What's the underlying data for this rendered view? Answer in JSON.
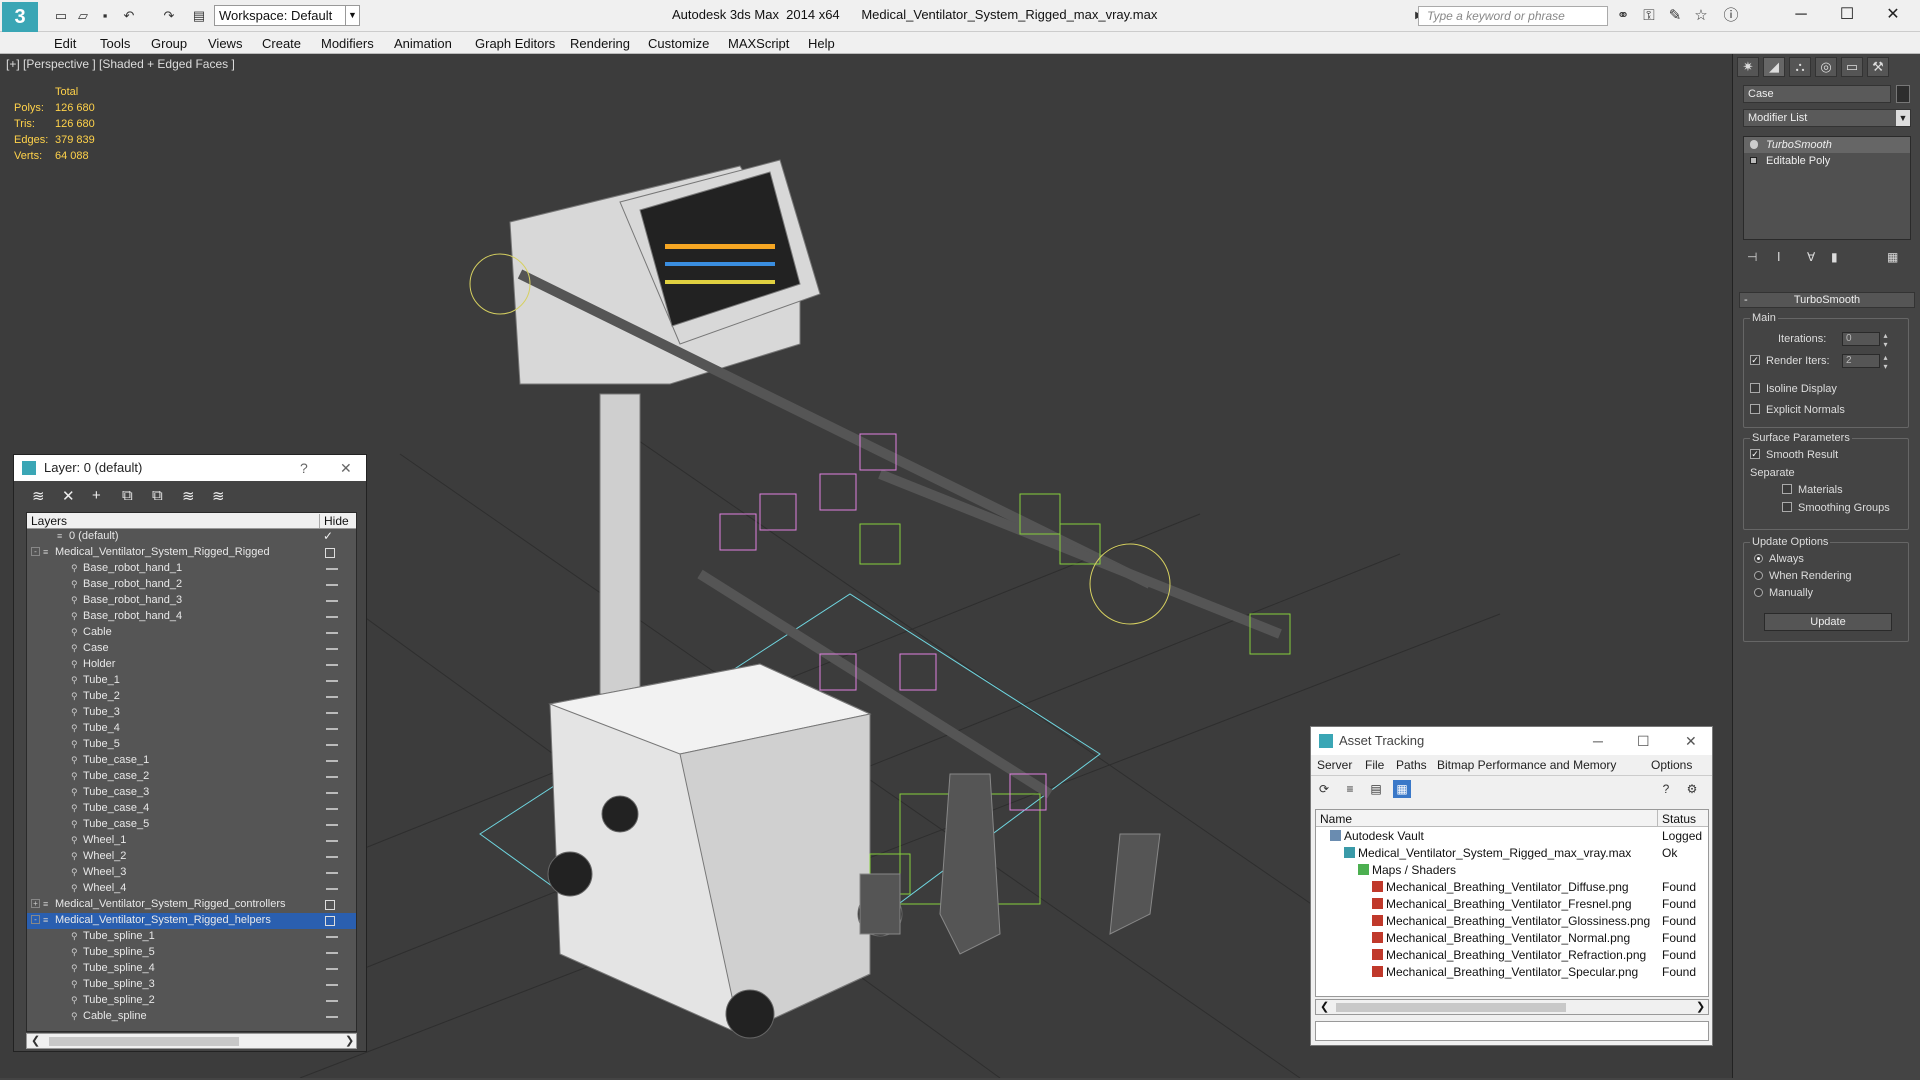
{
  "titlebar": {
    "workspace": "Workspace: Default",
    "app_name": "Autodesk 3ds Max  2014 x64",
    "file_name": "Medical_Ventilator_System_Rigged_max_vray.max",
    "search_placeholder": "Type a keyword or phrase"
  },
  "menu": [
    "Edit",
    "Tools",
    "Group",
    "Views",
    "Create",
    "Modifiers",
    "Animation",
    "Graph Editors",
    "Rendering",
    "Customize",
    "MAXScript",
    "Help"
  ],
  "viewport": {
    "label": "[+] [Perspective ] [Shaded + Edged Faces ]",
    "stats": {
      "header": "Total",
      "rows": [
        {
          "k": "Polys:",
          "v": "126 680"
        },
        {
          "k": "Tris:",
          "v": "126 680"
        },
        {
          "k": "Edges:",
          "v": "379 839"
        },
        {
          "k": "Verts:",
          "v": "64 088"
        }
      ]
    }
  },
  "layer_window": {
    "title": "Layer: 0 (default)",
    "help": "?",
    "close": "✕",
    "col_layers": "Layers",
    "col_hide": "Hide",
    "rows": [
      {
        "label": "0 (default)",
        "level": 1,
        "type": "layer",
        "mark": "✓"
      },
      {
        "label": "Medical_Ventilator_System_Rigged_Rigged",
        "level": 0,
        "type": "layer-exp",
        "mark": "box"
      },
      {
        "label": "Base_robot_hand_1",
        "level": 2,
        "type": "obj"
      },
      {
        "label": "Base_robot_hand_2",
        "level": 2,
        "type": "obj"
      },
      {
        "label": "Base_robot_hand_3",
        "level": 2,
        "type": "obj"
      },
      {
        "label": "Base_robot_hand_4",
        "level": 2,
        "type": "obj"
      },
      {
        "label": "Cable",
        "level": 2,
        "type": "obj"
      },
      {
        "label": "Case",
        "level": 2,
        "type": "obj"
      },
      {
        "label": "Holder",
        "level": 2,
        "type": "obj"
      },
      {
        "label": "Tube_1",
        "level": 2,
        "type": "obj"
      },
      {
        "label": "Tube_2",
        "level": 2,
        "type": "obj"
      },
      {
        "label": "Tube_3",
        "level": 2,
        "type": "obj"
      },
      {
        "label": "Tube_4",
        "level": 2,
        "type": "obj"
      },
      {
        "label": "Tube_5",
        "level": 2,
        "type": "obj"
      },
      {
        "label": "Tube_case_1",
        "level": 2,
        "type": "obj"
      },
      {
        "label": "Tube_case_2",
        "level": 2,
        "type": "obj"
      },
      {
        "label": "Tube_case_3",
        "level": 2,
        "type": "obj"
      },
      {
        "label": "Tube_case_4",
        "level": 2,
        "type": "obj"
      },
      {
        "label": "Tube_case_5",
        "level": 2,
        "type": "obj"
      },
      {
        "label": "Wheel_1",
        "level": 2,
        "type": "obj"
      },
      {
        "label": "Wheel_2",
        "level": 2,
        "type": "obj"
      },
      {
        "label": "Wheel_3",
        "level": 2,
        "type": "obj"
      },
      {
        "label": "Wheel_4",
        "level": 2,
        "type": "obj"
      },
      {
        "label": "Medical_Ventilator_System_Rigged_controllers",
        "level": 0,
        "type": "layer-col",
        "mark": "box"
      },
      {
        "label": "Medical_Ventilator_System_Rigged_helpers",
        "level": 0,
        "type": "layer-exp",
        "mark": "box",
        "selected": true
      },
      {
        "label": "Tube_spline_1",
        "level": 2,
        "type": "obj"
      },
      {
        "label": "Tube_spline_5",
        "level": 2,
        "type": "obj"
      },
      {
        "label": "Tube_spline_4",
        "level": 2,
        "type": "obj"
      },
      {
        "label": "Tube_spline_3",
        "level": 2,
        "type": "obj"
      },
      {
        "label": "Tube_spline_2",
        "level": 2,
        "type": "obj"
      },
      {
        "label": "Cable_spline",
        "level": 2,
        "type": "obj"
      }
    ]
  },
  "command_panel": {
    "object_name": "Case",
    "modifier_list": "Modifier List",
    "stack": [
      {
        "label": "TurboSmooth",
        "active": true
      },
      {
        "label": "Editable Poly",
        "active": false
      }
    ],
    "rollout_title": "TurboSmooth",
    "main_group": "Main",
    "iterations_label": "Iterations:",
    "iterations_value": "0",
    "render_iters_label": "Render Iters:",
    "render_iters_value": "2",
    "isoline_display": "Isoline Display",
    "explicit_normals": "Explicit Normals",
    "surface_group": "Surface Parameters",
    "smooth_result": "Smooth Result",
    "separate_label": "Separate",
    "materials": "Materials",
    "smoothing_groups": "Smoothing Groups",
    "update_group": "Update Options",
    "always": "Always",
    "when_rendering": "When Rendering",
    "manually": "Manually",
    "update_button": "Update"
  },
  "asset_window": {
    "title": "Asset Tracking",
    "menu": [
      "Server",
      "File",
      "Paths",
      "Bitmap Performance and Memory",
      "Options"
    ],
    "col_name": "Name",
    "col_status": "Status",
    "rows": [
      {
        "name": "Autodesk Vault",
        "status": "Logged",
        "indent": 1,
        "icon": "vault"
      },
      {
        "name": "Medical_Ventilator_System_Rigged_max_vray.max",
        "status": "Ok",
        "indent": 2,
        "icon": "max"
      },
      {
        "name": "Maps / Shaders",
        "status": "",
        "indent": 3,
        "icon": "folder"
      },
      {
        "name": "Mechanical_Breathing_Ventilator_Diffuse.png",
        "status": "Found",
        "indent": 4,
        "icon": "png"
      },
      {
        "name": "Mechanical_Breathing_Ventilator_Fresnel.png",
        "status": "Found",
        "indent": 4,
        "icon": "png"
      },
      {
        "name": "Mechanical_Breathing_Ventilator_Glossiness.png",
        "status": "Found",
        "indent": 4,
        "icon": "png"
      },
      {
        "name": "Mechanical_Breathing_Ventilator_Normal.png",
        "status": "Found",
        "indent": 4,
        "icon": "png"
      },
      {
        "name": "Mechanical_Breathing_Ventilator_Refraction.png",
        "status": "Found",
        "indent": 4,
        "icon": "png"
      },
      {
        "name": "Mechanical_Breathing_Ventilator_Specular.png",
        "status": "Found",
        "indent": 4,
        "icon": "png"
      }
    ]
  }
}
